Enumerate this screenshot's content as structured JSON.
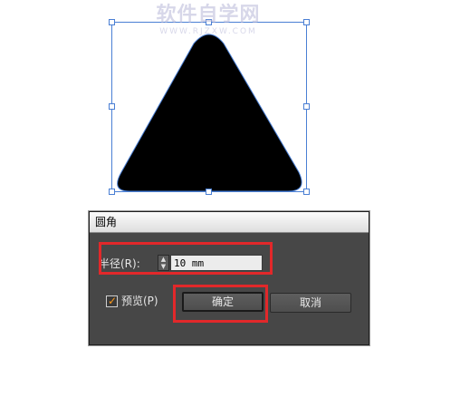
{
  "watermark": {
    "main": "软件自学网",
    "sub": "WWW.RJZXW.COM"
  },
  "dialog": {
    "title": "圆角",
    "radius_label": "半径(R):",
    "radius_value": "10 mm",
    "stepper_up_icon": "▲",
    "stepper_down_icon": "▼",
    "preview_label": "预览(P)",
    "preview_checked": true,
    "preview_check_icon": "✓",
    "ok_label": "确定",
    "cancel_label": "取消"
  },
  "colors": {
    "shape_fill": "#000000",
    "selection": "#4a7fd4",
    "dialog_bg": "#474747",
    "annotation": "#e2282a",
    "checkbox_mark": "#ff9a1a"
  }
}
